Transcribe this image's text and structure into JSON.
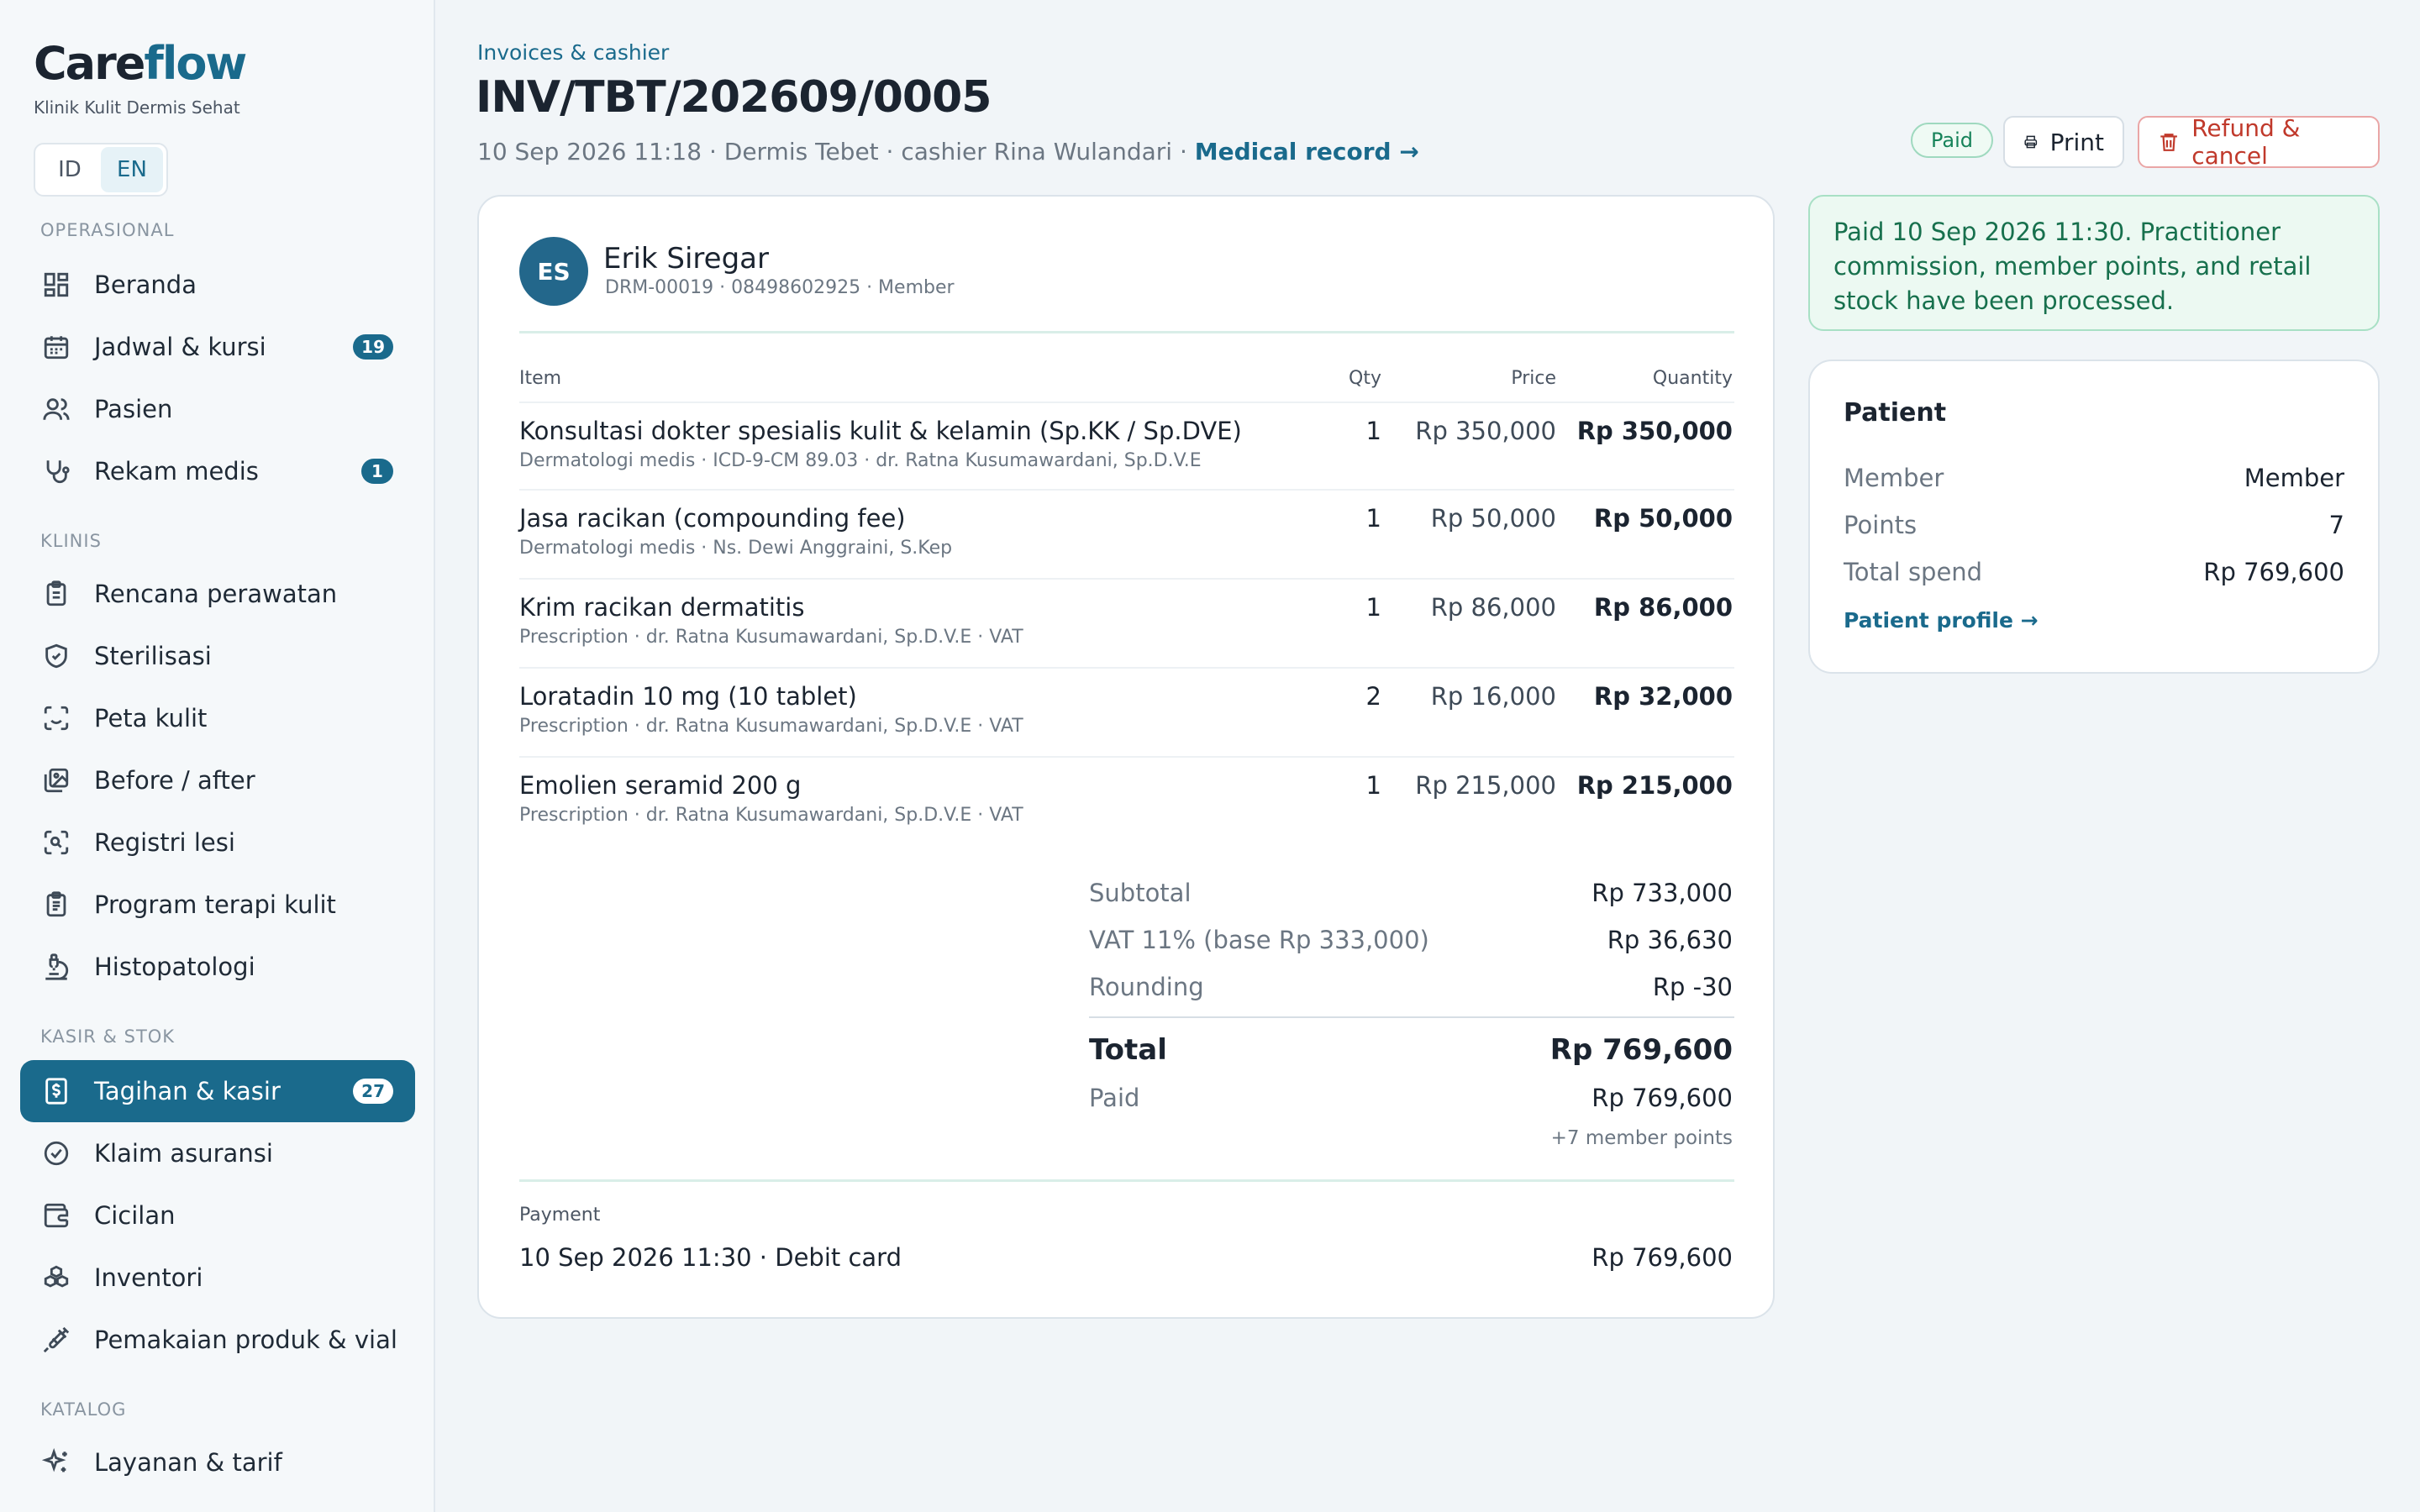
{
  "brand": {
    "name_main": "Care",
    "name_accent": "flow",
    "subtitle": "Klinik Kulit Dermis Sehat"
  },
  "lang": {
    "options": [
      "ID",
      "EN"
    ],
    "active": "EN"
  },
  "sidebar": {
    "sections": [
      {
        "title": "OPERASIONAL",
        "items": [
          {
            "label": "Beranda",
            "icon": "dashboard-icon"
          },
          {
            "label": "Jadwal & kursi",
            "icon": "calendar-icon",
            "badge": "19"
          },
          {
            "label": "Pasien",
            "icon": "users-icon"
          },
          {
            "label": "Rekam medis",
            "icon": "stethoscope-icon",
            "badge": "1"
          }
        ]
      },
      {
        "title": "KLINIS",
        "items": [
          {
            "label": "Rencana perawatan",
            "icon": "clipboard-icon"
          },
          {
            "label": "Sterilisasi",
            "icon": "shield-icon"
          },
          {
            "label": "Peta kulit",
            "icon": "scan-face-icon"
          },
          {
            "label": "Before / after",
            "icon": "images-icon"
          },
          {
            "label": "Registri lesi",
            "icon": "scan-search-icon"
          },
          {
            "label": "Program terapi kulit",
            "icon": "clipboard-list-icon"
          },
          {
            "label": "Histopatologi",
            "icon": "microscope-icon"
          }
        ]
      },
      {
        "title": "KASIR & STOK",
        "items": [
          {
            "label": "Tagihan & kasir",
            "icon": "receipt-icon",
            "badge": "27",
            "active": true
          },
          {
            "label": "Klaim asuransi",
            "icon": "check-circle-icon"
          },
          {
            "label": "Cicilan",
            "icon": "wallet-icon"
          },
          {
            "label": "Inventori",
            "icon": "boxes-icon"
          },
          {
            "label": "Pemakaian produk & vial",
            "icon": "syringe-icon"
          }
        ]
      },
      {
        "title": "KATALOG",
        "items": [
          {
            "label": "Layanan & tarif",
            "icon": "sparkles-icon"
          }
        ]
      }
    ]
  },
  "header": {
    "breadcrumb": "Invoices & cashier",
    "title": "INV/TBT/202609/0005",
    "meta": "10 Sep 2026 11:18 · Dermis Tebet · cashier Rina Wulandari · ",
    "meta_link": "Medical record →",
    "status": "Paid",
    "print_label": "Print",
    "refund_label": "Refund & cancel"
  },
  "invoice": {
    "patient_initials": "ES",
    "patient_name": "Erik Siregar",
    "patient_sub": "DRM-00019 · 08498602925 · Member",
    "columns": {
      "item": "Item",
      "qty": "Qty",
      "price": "Price",
      "quantity": "Quantity"
    },
    "items": [
      {
        "name": "Konsultasi dokter spesialis kulit & kelamin (Sp.KK / Sp.DVE)",
        "sub": "Dermatologi medis  · ICD-9-CM 89.03  · dr. Ratna Kusumawardani, Sp.D.V.E",
        "qty": "1",
        "price": "Rp 350,000",
        "total": "Rp 350,000"
      },
      {
        "name": "Jasa racikan (compounding fee)",
        "sub": "Dermatologi medis  · Ns. Dewi Anggraini, S.Kep",
        "qty": "1",
        "price": "Rp 50,000",
        "total": "Rp 50,000"
      },
      {
        "name": "Krim racikan dermatitis",
        "sub": "Prescription  · dr. Ratna Kusumawardani, Sp.D.V.E  · VAT",
        "qty": "1",
        "price": "Rp 86,000",
        "total": "Rp 86,000"
      },
      {
        "name": "Loratadin 10 mg (10 tablet)",
        "sub": "Prescription  · dr. Ratna Kusumawardani, Sp.D.V.E  · VAT",
        "qty": "2",
        "price": "Rp 16,000",
        "total": "Rp 32,000"
      },
      {
        "name": "Emolien seramid 200 g",
        "sub": "Prescription  · dr. Ratna Kusumawardani, Sp.D.V.E  · VAT",
        "qty": "1",
        "price": "Rp 215,000",
        "total": "Rp 215,000"
      }
    ],
    "summary": {
      "subtotal_label": "Subtotal",
      "subtotal": "Rp 733,000",
      "vat_label": "VAT 11% (base Rp 333,000)",
      "vat": "Rp 36,630",
      "rounding_label": "Rounding",
      "rounding": "Rp -30",
      "total_label": "Total",
      "total": "Rp 769,600",
      "paid_label": "Paid",
      "paid": "Rp 769,600",
      "points_note": "+7 member points"
    },
    "payment": {
      "heading": "Payment",
      "line": "10 Sep 2026 11:30 · Debit card",
      "amount": "Rp 769,600"
    }
  },
  "notice": "Paid 10 Sep 2026 11:30. Practitioner commission, member points, and retail stock have been processed.",
  "patient_card": {
    "title": "Patient",
    "rows": [
      {
        "label": "Member",
        "value": "Member"
      },
      {
        "label": "Points",
        "value": "7"
      },
      {
        "label": "Total spend",
        "value": "Rp 769,600"
      }
    ],
    "link": "Patient profile →"
  },
  "colors": {
    "accent": "#1a6a8c",
    "paid": "#17835a",
    "danger": "#c0392b"
  }
}
